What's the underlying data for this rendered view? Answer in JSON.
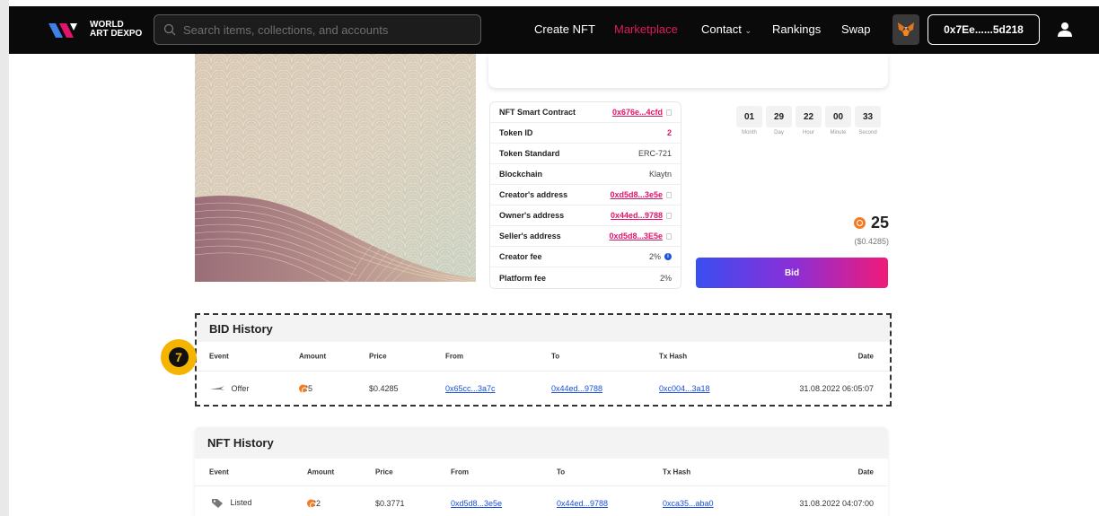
{
  "header": {
    "logo_line1": "WORLD",
    "logo_line2": "ART DEXPO",
    "search_placeholder": "Search items, collections, and accounts",
    "nav": [
      "Create NFT",
      "Marketplace",
      "Contact",
      "Rankings",
      "Swap"
    ],
    "contact_chevron": "⌄",
    "active_nav": "Marketplace",
    "wallet": "0x7Ee......5d218"
  },
  "details": [
    {
      "label": "NFT Smart Contract",
      "value": "0x676e...4cfd",
      "style": "link",
      "copy": true
    },
    {
      "label": "Token ID",
      "value": "2",
      "style": "pink",
      "copy": false
    },
    {
      "label": "Token Standard",
      "value": "ERC-721",
      "style": "plain",
      "copy": false
    },
    {
      "label": "Blockchain",
      "value": "Klaytn",
      "style": "plain",
      "copy": false
    },
    {
      "label": "Creator's address",
      "value": "0xd5d8...3e5e",
      "style": "link",
      "copy": true
    },
    {
      "label": "Owner's address",
      "value": "0x44ed...9788",
      "style": "link",
      "copy": true
    },
    {
      "label": "Seller's address",
      "value": "0xd5d8...3E5e",
      "style": "link",
      "copy": true
    },
    {
      "label": "Creator fee",
      "value": "2%",
      "style": "plain",
      "info": true
    },
    {
      "label": "Platform fee",
      "value": "2%",
      "style": "plain"
    }
  ],
  "countdown": [
    {
      "value": "01",
      "label": "Month"
    },
    {
      "value": "29",
      "label": "Day"
    },
    {
      "value": "22",
      "label": "Hour"
    },
    {
      "value": "00",
      "label": "Minute"
    },
    {
      "value": "33",
      "label": "Second"
    }
  ],
  "price": {
    "value": "25",
    "usd": "($0.4285)"
  },
  "bid_button": "Bid",
  "marker": "7",
  "bid_history": {
    "title": "BID History",
    "columns": [
      "Event",
      "Amount",
      "Price",
      "From",
      "To",
      "Tx Hash",
      "Date"
    ],
    "rows": [
      {
        "event": "Offer",
        "amount": "25",
        "price": "$0.4285",
        "from": "0x65cc...3a7c",
        "to": "0x44ed...9788",
        "tx": "0xc004...3a18",
        "date": "31.08.2022 06:05:07"
      }
    ]
  },
  "nft_history": {
    "title": "NFT History",
    "columns": [
      "Event",
      "Amount",
      "Price",
      "From",
      "To",
      "Tx Hash",
      "Date"
    ],
    "rows": [
      {
        "event": "Listed",
        "amount": "22",
        "price": "$0.3771",
        "from": "0xd5d8...3e5e",
        "to": "0x44ed...9788",
        "tx": "0xca35...aba0",
        "date": "31.08.2022 04:07:00"
      }
    ]
  },
  "colors": {
    "accent": "#e0156a",
    "link": "#1a4fd8",
    "coin": "#f47b20",
    "marker": "#f5b400"
  }
}
